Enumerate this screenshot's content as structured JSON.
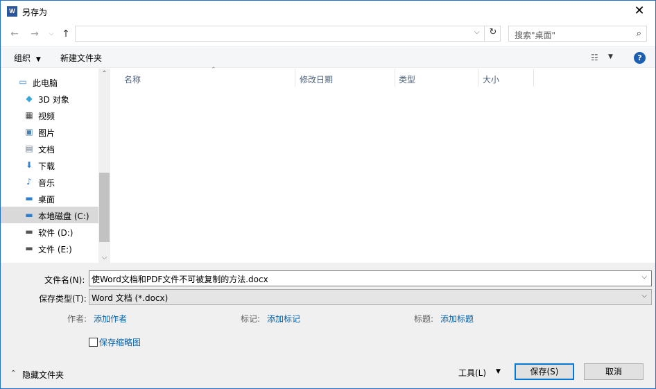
{
  "window": {
    "title": "另存为",
    "app_icon_letter": "W"
  },
  "address": {
    "path": ""
  },
  "search": {
    "placeholder": "搜索\"桌面\""
  },
  "toolbar": {
    "organize": "组织",
    "new_folder": "新建文件夹",
    "help": "?"
  },
  "nav": {
    "items": [
      {
        "label": "此电脑",
        "icon": "computer-icon",
        "indent": 0,
        "selected": false
      },
      {
        "label": "3D 对象",
        "icon": "3d-objects-icon",
        "indent": 1,
        "selected": false
      },
      {
        "label": "视频",
        "icon": "video-icon",
        "indent": 1,
        "selected": false
      },
      {
        "label": "图片",
        "icon": "pictures-icon",
        "indent": 1,
        "selected": false
      },
      {
        "label": "文档",
        "icon": "documents-icon",
        "indent": 1,
        "selected": false
      },
      {
        "label": "下载",
        "icon": "downloads-icon",
        "indent": 1,
        "selected": false
      },
      {
        "label": "音乐",
        "icon": "music-icon",
        "indent": 1,
        "selected": false
      },
      {
        "label": "桌面",
        "icon": "desktop-icon",
        "indent": 1,
        "selected": false
      },
      {
        "label": "本地磁盘 (C:)",
        "icon": "windows-drive-icon",
        "indent": 1,
        "selected": true
      },
      {
        "label": "软件 (D:)",
        "icon": "drive-icon",
        "indent": 1,
        "selected": false
      },
      {
        "label": "文件 (E:)",
        "icon": "drive-icon",
        "indent": 1,
        "selected": false
      }
    ]
  },
  "columns": [
    "名称",
    "修改日期",
    "类型",
    "大小"
  ],
  "form": {
    "filename_label": "文件名(N):",
    "filename_value": "使Word文档和PDF文件不可被复制的方法.docx",
    "filetype_label": "保存类型(T):",
    "filetype_value": "Word 文档 (*.docx)",
    "author_label": "作者:",
    "author_value": "添加作者",
    "tags_label": "标记:",
    "tags_value": "添加标记",
    "title_label": "标题:",
    "title_value": "添加标题",
    "thumbnail_label": "保存缩略图"
  },
  "footer": {
    "hide_folders": "隐藏文件夹",
    "tools": "工具(L)",
    "save": "保存(S)",
    "cancel": "取消"
  },
  "colors": {
    "accent": "#0078d7",
    "link": "#0063b1",
    "word_blue": "#2b579a"
  }
}
